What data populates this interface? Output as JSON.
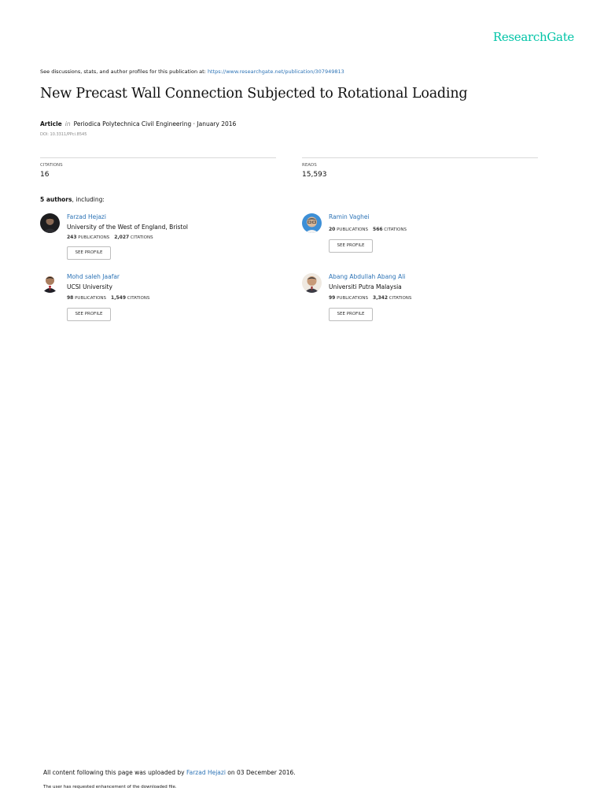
{
  "brand": "ResearchGate",
  "discussion": {
    "text": "See discussions, stats, and author profiles for this publication at: ",
    "link": "https://www.researchgate.net/publication/307949813"
  },
  "title": "New Precast Wall Connection Subjected to Rotational Loading",
  "meta": {
    "type": "Article",
    "in": "in",
    "journal": "Periodica Polytechnica Civil Engineering · January 2016",
    "doi": "DOI: 10.3311/PPci.8545"
  },
  "stats": {
    "citations_label": "CITATIONS",
    "citations": "16",
    "reads_label": "READS",
    "reads": "15,593"
  },
  "authors_heading": {
    "count": "5 authors",
    "suffix": ", including:"
  },
  "authors": [
    {
      "name": "Farzad Hejazi",
      "institution": "University of the West of England, Bristol",
      "publications": "243",
      "publications_label": "PUBLICATIONS",
      "citations": "2,027",
      "citations_label": "CITATIONS",
      "button": "SEE PROFILE"
    },
    {
      "name": "Ramin Vaghei",
      "institution": "",
      "publications": "20",
      "publications_label": "PUBLICATIONS",
      "citations": "566",
      "citations_label": "CITATIONS",
      "button": "SEE PROFILE"
    },
    {
      "name": "Mohd saleh Jaafar",
      "institution": "UCSI University",
      "publications": "98",
      "publications_label": "PUBLICATIONS",
      "citations": "1,549",
      "citations_label": "CITATIONS",
      "button": "SEE PROFILE"
    },
    {
      "name": "Abang Abdullah Abang Ali",
      "institution": "Universiti Putra Malaysia",
      "publications": "99",
      "publications_label": "PUBLICATIONS",
      "citations": "3,342",
      "citations_label": "CITATIONS",
      "button": "SEE PROFILE"
    }
  ],
  "footer": {
    "prefix": "All content following this page was uploaded by ",
    "uploader": "Farzad Hejazi",
    "suffix": " on 03 December 2016.",
    "note": "The user has requested enhancement of the downloaded file."
  },
  "colors": {
    "brand": "#00c4a7",
    "link": "#2c73b6"
  }
}
